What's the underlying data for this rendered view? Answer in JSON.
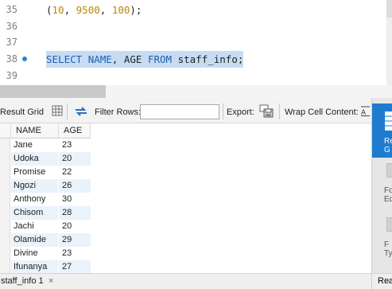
{
  "editor": {
    "lines": [
      {
        "num": "35",
        "parts": [
          {
            "t": "(",
            "c": "p"
          },
          {
            "t": "10",
            "c": "num"
          },
          {
            "t": ", ",
            "c": "p"
          },
          {
            "t": "9500",
            "c": "num"
          },
          {
            "t": ", ",
            "c": "p"
          },
          {
            "t": "100",
            "c": "num"
          },
          {
            "t": ");",
            "c": "p"
          }
        ],
        "selected": false,
        "breakpoint": false
      },
      {
        "num": "36",
        "parts": [],
        "selected": false,
        "breakpoint": false
      },
      {
        "num": "37",
        "parts": [],
        "selected": false,
        "breakpoint": false
      },
      {
        "num": "38",
        "parts": [
          {
            "t": "SELECT",
            "c": "kw"
          },
          {
            "t": " ",
            "c": "p"
          },
          {
            "t": "NAME",
            "c": "kw"
          },
          {
            "t": ", AGE ",
            "c": "p"
          },
          {
            "t": "FROM",
            "c": "kw"
          },
          {
            "t": " staff_info;",
            "c": "p"
          }
        ],
        "selected": true,
        "breakpoint": true
      },
      {
        "num": "39",
        "parts": [],
        "selected": false,
        "breakpoint": false
      }
    ]
  },
  "toolbar": {
    "result_grid_label": "Result Grid",
    "result_grid_icon": "grid-icon",
    "refresh_icon": "refresh-arrows-icon",
    "filter_rows_label": "Filter Rows:",
    "filter_rows_value": "",
    "export_label": "Export:",
    "export_icon": "export-save-icon",
    "wrap_label": "Wrap Cell Content:",
    "wrap_icon": "wrap-text-icon"
  },
  "grid": {
    "columns": [
      "NAME",
      "AGE"
    ],
    "rows": [
      [
        "Jane",
        "23"
      ],
      [
        "Udoka",
        "20"
      ],
      [
        "Promise",
        "22"
      ],
      [
        "Ngozi",
        "26"
      ],
      [
        "Anthony",
        "30"
      ],
      [
        "Chisom",
        "28"
      ],
      [
        "Jachi",
        "20"
      ],
      [
        "Olamide",
        "29"
      ],
      [
        "Divine",
        "23"
      ],
      [
        "Ifunanya",
        "27"
      ]
    ]
  },
  "bottom": {
    "tab_label": "staff_info 1",
    "close_glyph": "×",
    "readonly_label": "Read"
  },
  "side": {
    "result_grid_partial_1": "Re",
    "result_grid_partial_2": "G",
    "form_editor_partial_1": "Fo",
    "form_editor_partial_2": "Ed",
    "field_types_partial_1": "F",
    "field_types_partial_2": "Ty"
  },
  "colors": {
    "selection": "#c5dcf3",
    "keyword": "#1f5fb0",
    "number": "#b8860b",
    "active_side": "#1e7bd0"
  }
}
